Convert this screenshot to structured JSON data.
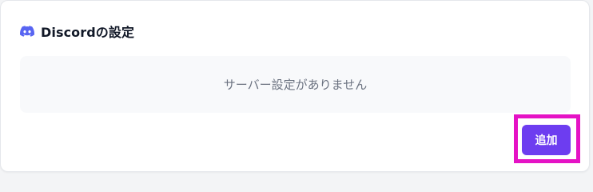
{
  "colors": {
    "discord": "#5865f2",
    "button_bg": "#6d3df0",
    "highlight": "#e512c5",
    "empty_bg": "#f8f9fb",
    "empty_text": "#6b7280"
  },
  "header": {
    "icon": "discord-icon",
    "title": "Discordの設定"
  },
  "empty_state": {
    "text": "サーバー設定がありません"
  },
  "actions": {
    "add_label": "追加"
  }
}
